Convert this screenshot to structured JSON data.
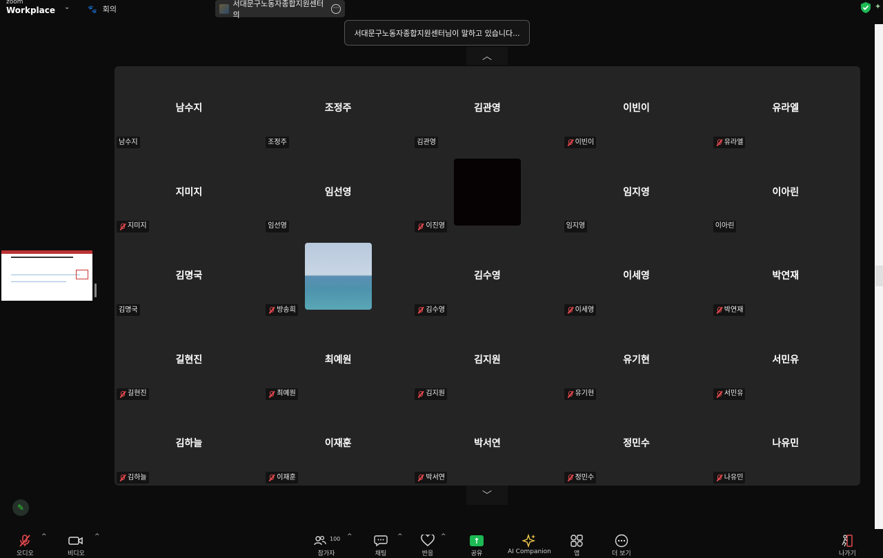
{
  "topbar": {
    "logo_small": "zoom",
    "logo_big": "Workplace",
    "menu_label": "회의",
    "meeting_title": "서대문구노동자종합지원센터의",
    "more_label": "···"
  },
  "speaking_banner": "서대문구노동자종합지원센터님이 말하고 있습니다...",
  "participants": [
    {
      "display": "남수지",
      "tag": "남수지",
      "muted": false
    },
    {
      "display": "조정주",
      "tag": "조정주",
      "muted": false
    },
    {
      "display": "김관영",
      "tag": "김관영",
      "muted": false
    },
    {
      "display": "이빈이",
      "tag": "이빈이",
      "muted": true
    },
    {
      "display": "유라엘",
      "tag": "유라엘",
      "muted": true
    },
    {
      "display": "지미지",
      "tag": "지미지",
      "muted": true
    },
    {
      "display": "임선영",
      "tag": "임선영",
      "muted": false
    },
    {
      "display": "",
      "tag": "이진영",
      "muted": true,
      "video": "dark"
    },
    {
      "display": "임지영",
      "tag": "임지영",
      "muted": false
    },
    {
      "display": "이아린",
      "tag": "이아린",
      "muted": false
    },
    {
      "display": "김명국",
      "tag": "김명국",
      "muted": false
    },
    {
      "display": "",
      "tag": "방송희",
      "muted": true,
      "video": "sea"
    },
    {
      "display": "김수영",
      "tag": "김수영",
      "muted": true
    },
    {
      "display": "이세영",
      "tag": "이세영",
      "muted": true
    },
    {
      "display": "박연재",
      "tag": "박연재",
      "muted": true
    },
    {
      "display": "길현진",
      "tag": "길현진",
      "muted": true
    },
    {
      "display": "최예원",
      "tag": "최예원",
      "muted": true
    },
    {
      "display": "김지원",
      "tag": "김지원",
      "muted": true
    },
    {
      "display": "유기현",
      "tag": "유기현",
      "muted": true
    },
    {
      "display": "서민유",
      "tag": "서민유",
      "muted": true
    },
    {
      "display": "김하늘",
      "tag": "김하늘",
      "muted": true
    },
    {
      "display": "이재훈",
      "tag": "이재훈",
      "muted": true
    },
    {
      "display": "박서연",
      "tag": "박서연",
      "muted": true
    },
    {
      "display": "정민수",
      "tag": "정민수",
      "muted": true
    },
    {
      "display": "나유민",
      "tag": "나유민",
      "muted": true
    }
  ],
  "toolbar": {
    "audio": "오디오",
    "video": "비디오",
    "participants": "참가자",
    "participant_count": "100",
    "chat": "채팅",
    "reactions": "반응",
    "share": "공유",
    "ai": "AI Companion",
    "apps": "앱",
    "more": "더 보기",
    "leave": "나가기"
  },
  "colors": {
    "mute_red": "#e5484d",
    "share_green": "#1db954",
    "gallery_bg": "#242424"
  }
}
